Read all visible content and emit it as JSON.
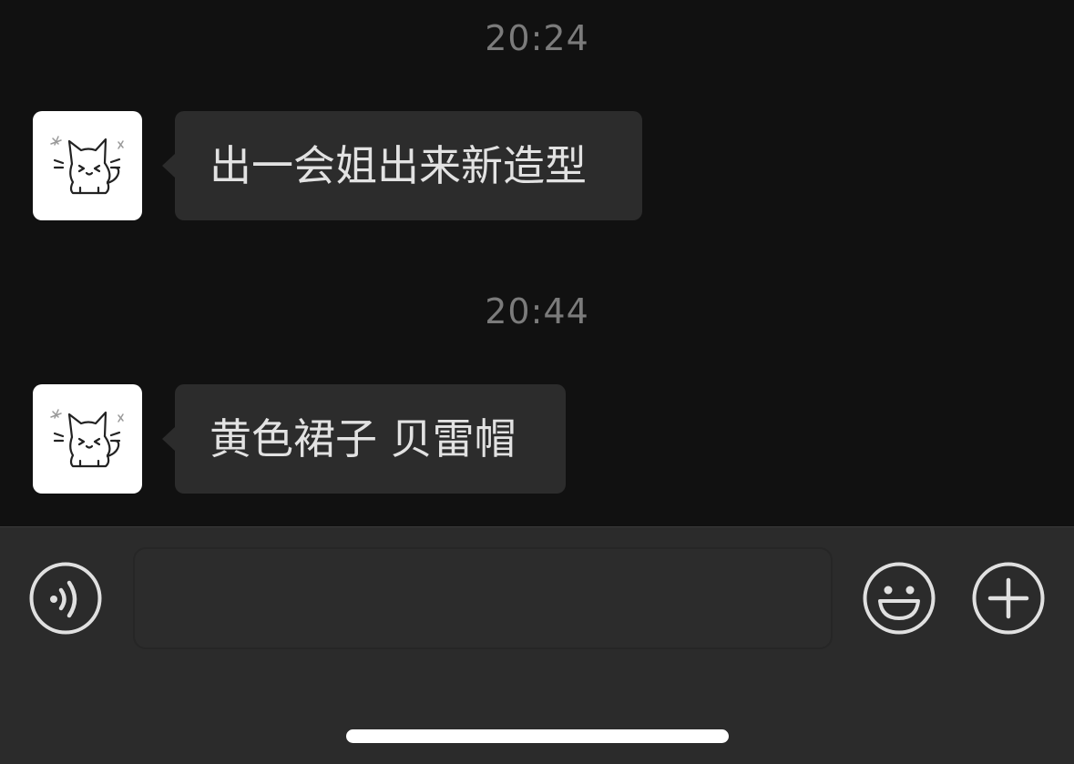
{
  "messages": [
    {
      "timestamp": "20:24",
      "text": "出一会姐出来新造型",
      "sender": "other"
    },
    {
      "timestamp": "20:44",
      "text": "黄色裙子 贝雷帽",
      "sender": "other"
    }
  ],
  "input_bar": {
    "value": "",
    "voice_icon": "voice-icon",
    "emoji_icon": "emoji-icon",
    "more_icon": "plus-icon"
  },
  "colors": {
    "background": "#111111",
    "bubble": "#2c2c2c",
    "bubble_text": "#e2e2e2",
    "timestamp": "#7b7b7b",
    "input_bar": "#2b2b2b",
    "icon": "#e0e0e0"
  }
}
